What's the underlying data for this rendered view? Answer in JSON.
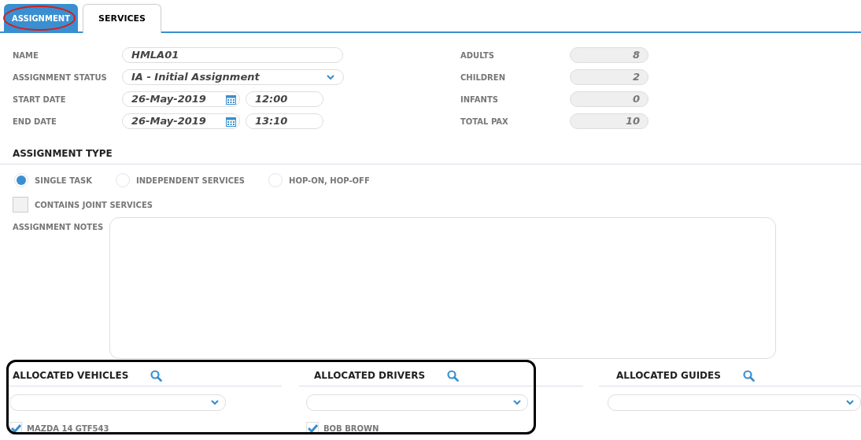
{
  "tabs": [
    {
      "label": "ASSIGNMENT",
      "selected": true
    },
    {
      "label": "SERVICES",
      "selected": false
    }
  ],
  "form_left": [
    {
      "label": "NAME",
      "kind": "text",
      "value": "HMLA01"
    },
    {
      "label": "ASSIGNMENT STATUS",
      "kind": "select",
      "value": "IA - Initial Assignment"
    },
    {
      "label": "START DATE",
      "kind": "datetime",
      "value": "26-May-2019",
      "time": "12:00"
    },
    {
      "label": "END DATE",
      "kind": "datetime",
      "value": "26-May-2019",
      "time": "13:10"
    }
  ],
  "form_right": [
    {
      "label": "ADULTS",
      "value": "8"
    },
    {
      "label": "CHILDREN",
      "value": "2"
    },
    {
      "label": "INFANTS",
      "value": "0"
    },
    {
      "label": "TOTAL PAX",
      "value": "10"
    }
  ],
  "assignment_type": {
    "title": "ASSIGNMENT TYPE",
    "options": [
      {
        "label": "SINGLE TASK",
        "selected": true
      },
      {
        "label": "INDEPENDENT SERVICES",
        "selected": false
      },
      {
        "label": "HOP-ON, HOP-OFF",
        "selected": false
      }
    ]
  },
  "joint_services": {
    "label": "CONTAINS JOINT SERVICES",
    "checked": false
  },
  "notes": {
    "label": "ASSIGNMENT NOTES"
  },
  "allocations": [
    {
      "title": "ALLOCATED VEHICLES",
      "items": [
        {
          "label": "MAZDA 14 GTF543",
          "checked": true
        }
      ]
    },
    {
      "title": "ALLOCATED DRIVERS",
      "items": [
        {
          "label": "BOB BROWN",
          "checked": true
        }
      ]
    },
    {
      "title": "ALLOCATED GUIDES"
    }
  ]
}
